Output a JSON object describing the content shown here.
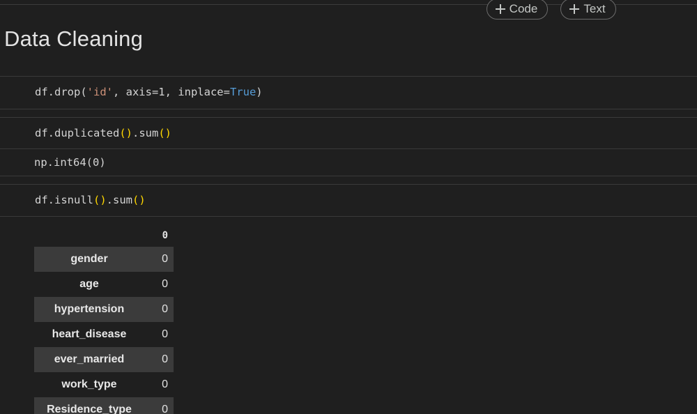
{
  "toolbar": {
    "add_code_label": "Code",
    "add_text_label": "Text"
  },
  "heading": "Data Cleaning",
  "cells": {
    "drop": {
      "p1": "df.drop(",
      "str": "'id'",
      "p2": ", axis=1, inplace=",
      "kw": "True",
      "p3": ")"
    },
    "duplicated": {
      "p1": "df.duplicated",
      "paren1": "()",
      "p2": ".sum",
      "paren2": "()",
      "output": "np.int64(0)"
    },
    "isnull": {
      "p1": "df.isnull",
      "paren1": "()",
      "p2": ".sum",
      "paren2": "()"
    }
  },
  "table": {
    "column_header": "0",
    "rows": [
      {
        "label": "gender",
        "value": "0"
      },
      {
        "label": "age",
        "value": "0"
      },
      {
        "label": "hypertension",
        "value": "0"
      },
      {
        "label": "heart_disease",
        "value": "0"
      },
      {
        "label": "ever_married",
        "value": "0"
      },
      {
        "label": "work_type",
        "value": "0"
      },
      {
        "label": "Residence_type",
        "value": "0"
      }
    ]
  }
}
